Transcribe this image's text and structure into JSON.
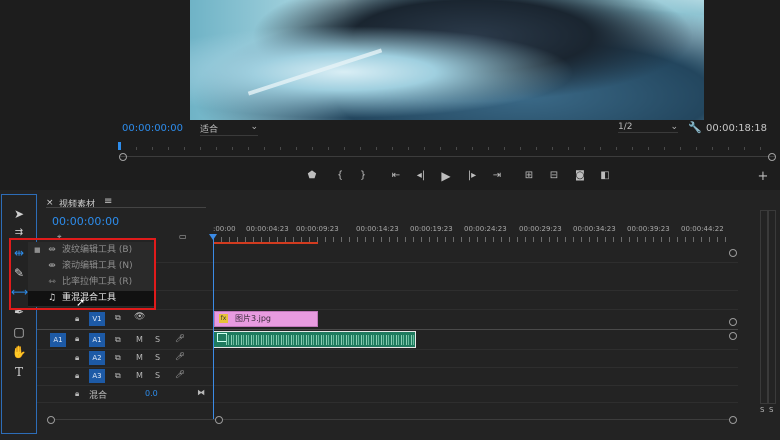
{
  "program_monitor": {
    "timecode_left": "00:00:00:00",
    "zoom_select": "适合",
    "resolution_select": "1/2",
    "timecode_right": "00:00:18:18"
  },
  "timeline": {
    "panel_title": "视频素材",
    "timecode": "00:00:00:00",
    "ruler": [
      ":00:00",
      "00:00:04:23",
      "00:00:09:23",
      "00:00:14:23",
      "00:00:19:23",
      "00:00:24:23",
      "00:00:29:23",
      "00:00:34:23",
      "00:00:39:23",
      "00:00:44:22"
    ],
    "tracks": {
      "v1": "V1",
      "a1_src": "A1",
      "a1": "A1",
      "a2": "A2",
      "a3": "A3",
      "mix_label": "混合",
      "mix_value": "0.0",
      "m": "M",
      "s": "S"
    },
    "clips": {
      "video_clip": "图片3.jpg",
      "fx": "fx"
    }
  },
  "tool_menu": {
    "items": [
      {
        "label": "波纹编辑工具",
        "shortcut": "(B)"
      },
      {
        "label": "滚动编辑工具",
        "shortcut": "(N)"
      },
      {
        "label": "比率拉伸工具",
        "shortcut": "(R)"
      },
      {
        "label": "重混混合工具",
        "shortcut": ""
      }
    ]
  },
  "audio_meter": {
    "solo_left": "S",
    "solo_right": "S"
  },
  "colors": {
    "accent": "#2d8ceb",
    "highlight_box": "#e01b1b",
    "video_clip": "#e89be0",
    "audio_clip": "#1f7a5e"
  }
}
